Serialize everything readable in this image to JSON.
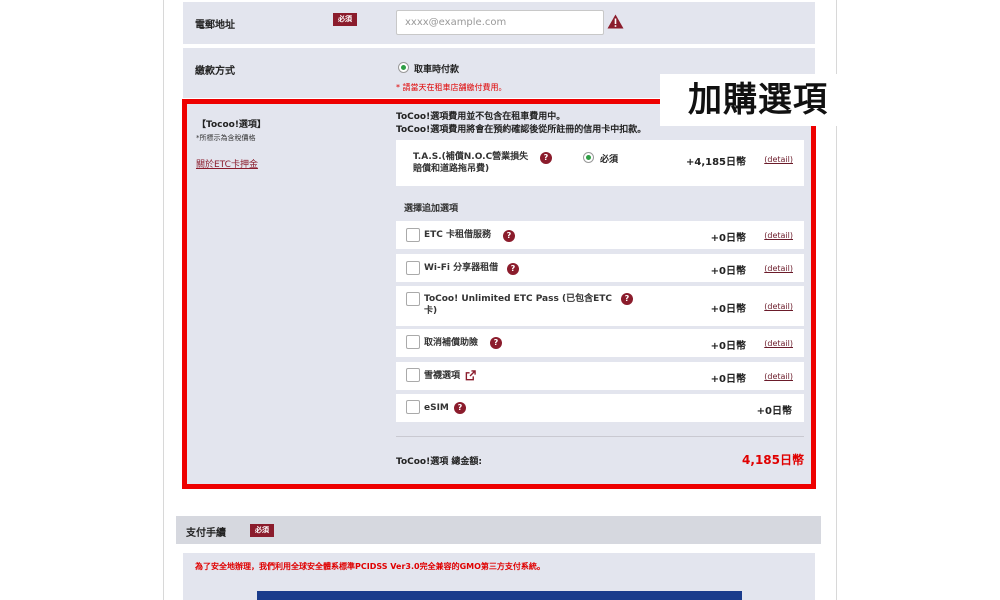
{
  "email": {
    "label": "電郵地址",
    "required_badge": "必須",
    "placeholder": "xxxx@example.com"
  },
  "payment_method": {
    "label": "繳款方式",
    "option_label": "取車時付款",
    "note": "* 請當天在租車店舗繳付費用。"
  },
  "callout": "加購選項",
  "options": {
    "section_title": "【Tocoo!選項】",
    "tax_note": "*所標示為含稅價格",
    "etc_link": "關於ETC卡押金",
    "intro_line1": "ToCoo!選項費用並不包含在租車費用中。",
    "intro_line2": "ToCoo!選項費用將會在預約確認後從所註冊的信用卡中扣款。",
    "tas": {
      "name_line1": "T.A.S.(補償N.O.C營業損失",
      "name_line2": "賠償和道路拖吊費)",
      "required_label": "必須",
      "price": "+4,185日幣",
      "detail": "(detail)"
    },
    "choose_heading": "選擇追加選項",
    "items": [
      {
        "name": "ETC 卡租借服務",
        "price": "+0日幣",
        "detail": "(detail)"
      },
      {
        "name": "Wi-Fi 分享器租借",
        "price": "+0日幣",
        "detail": "(detail)"
      },
      {
        "name_line1": "ToCoo! Unlimited ETC Pass (已包含ETC",
        "name_line2": "卡)",
        "price": "+0日幣",
        "detail": "(detail)"
      },
      {
        "name": "取消補償助險",
        "price": "+0日幣",
        "detail": "(detail)"
      },
      {
        "name": "雪襪選項",
        "price": "+0日幣",
        "detail": "(detail)"
      },
      {
        "name": "eSIM",
        "price": "+0日幣"
      }
    ],
    "total_label": "ToCoo!選項 總金額:",
    "total_value": "4,185日幣"
  },
  "payment": {
    "title": "支付手續",
    "required_badge": "必須",
    "note": "為了安全地辦理，我們利用全球安全體系標準PCIDSS Ver3.0完全兼容的GMO第三方支付系統。"
  },
  "colors": {
    "accent_red": "#ee0000",
    "badge": "#8b1c2c",
    "row_bg": "#e3e5ee",
    "radio_green": "#2e9e45"
  }
}
